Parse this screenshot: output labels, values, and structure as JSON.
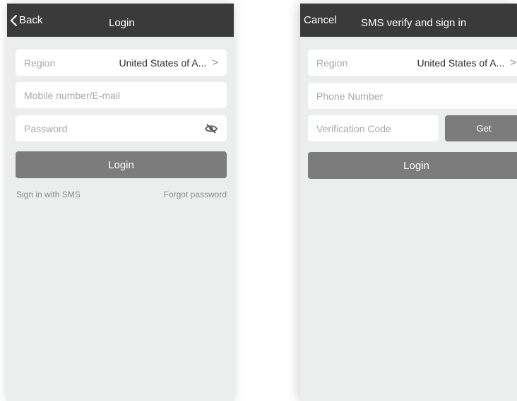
{
  "login_screen": {
    "nav": {
      "back_label": "Back",
      "title": "Login"
    },
    "region": {
      "label": "Region",
      "value": "United States of A...",
      "chevron": ">"
    },
    "account_field": {
      "placeholder": "Mobile number/E-mail"
    },
    "password_field": {
      "placeholder": "Password"
    },
    "login_button": "Login",
    "sms_link": "Sign in with SMS",
    "forgot_link": "Forgot password"
  },
  "sms_screen": {
    "nav": {
      "cancel_label": "Cancel",
      "title": "SMS verify and sign in"
    },
    "region": {
      "label": "Region",
      "value": "United States of A...",
      "chevron": ">"
    },
    "phone_field": {
      "placeholder": "Phone Number"
    },
    "code_field": {
      "placeholder": "Verification Code"
    },
    "get_button": "Get",
    "login_button": "Login"
  },
  "colors": {
    "navbar": "#3a3a3a",
    "background": "#eceeed",
    "button": "#7c7c7c",
    "input": "#ffffff"
  },
  "icons": [
    "chevron-left-icon",
    "eye-off-icon",
    "chevron-right-icon"
  ]
}
